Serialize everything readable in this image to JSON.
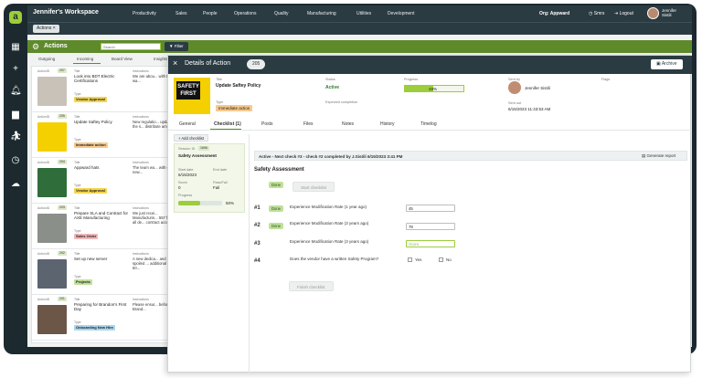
{
  "app": {
    "workspace_title": "Jennifer's Workspace",
    "nav": [
      "Productivity",
      "Sales",
      "People",
      "Operations",
      "Quality",
      "Manufacturing",
      "Utilities",
      "Development"
    ],
    "org": "Org: Appward",
    "smrs": "Smrs",
    "logout": "Logout",
    "user_first": "Jennifer",
    "user_last": "Sistili",
    "actions_chip": "Actions ×"
  },
  "actions": {
    "title": "Actions",
    "search_placeholder": "Search",
    "filter_label": "Filter",
    "tabs": [
      "Outgoing",
      "Incoming",
      "Board View",
      "Insights"
    ]
  },
  "list_labels": {
    "title": "Title",
    "type": "Type",
    "instructions": "Instructions"
  },
  "list": [
    {
      "id": "ActionID",
      "badge": "207",
      "title": "Look into BDT Electric Certifications",
      "type": "Vendor Approval",
      "type_color": "#f4d54d",
      "instr": "We are abou... with the wa...",
      "thumb": "#c9c2b8"
    },
    {
      "id": "ActionID",
      "badge": "205",
      "title": "Update Saftey Policy",
      "type": "Immediate action",
      "type_color": "#f7c98d",
      "instr": "New regulatio... update the s... distribute am...",
      "thumb": "#f4d000"
    },
    {
      "id": "ActionID",
      "badge": "204",
      "title": "Appward hats",
      "type": "Vendor Approval",
      "type_color": "#f4d54d",
      "instr": "The team wo... with our new...",
      "thumb": "#2f6d3a"
    },
    {
      "id": "ActionID",
      "badge": "203",
      "title": "Prepare SLA and Contract for AXE Manufacturing",
      "type": "Sales Order",
      "type_color": "#f0b8b8",
      "instr": "We just recei... Manufacturin... 557 for all de... contract acco...",
      "thumb": "#8a8f8a"
    },
    {
      "id": "ActionID",
      "badge": "202",
      "title": "Set up new server",
      "type": "Projects",
      "type_color": "#bfe09a",
      "instr": "A new dedica... and spoiled ... additional 50...",
      "thumb": "#5c6470"
    },
    {
      "id": "ActionID",
      "badge": "201",
      "title": "Preparing for Brandon's First Day",
      "type": "Onboarding New Hire",
      "type_color": "#a9d6ef",
      "instr": "Please ensur... before Brand...",
      "thumb": "#6c5648"
    }
  ],
  "detail": {
    "header": "Details of Action",
    "number": "205",
    "archive": "Archive",
    "hero_sign": "SAFETY FIRST",
    "labels": {
      "title": "Title",
      "status": "Status",
      "progress": "Progress",
      "sent_by": "Sent by",
      "flags": "Flags",
      "type": "Type",
      "expected": "Expected completion",
      "sent_out": "Sent out"
    },
    "title": "Update Saftey Policy",
    "status": "Active",
    "progress": 0.48,
    "progress_text": "48%",
    "type": "Immediate action",
    "sent_by": "Jennifer Sistili",
    "sent_out": "6/15/2023 11:43:53 AM",
    "tabs": [
      "General",
      "Checklist (1)",
      "Posts",
      "Files",
      "Notes",
      "History",
      "Timelog"
    ]
  },
  "checklist_card": {
    "add_label": "Add checklist",
    "session_label": "Session ID",
    "session_id": "1696",
    "name": "Safety Assessment",
    "start_label": "Start date",
    "start": "6/15/2023",
    "end_label": "End date",
    "score_label": "Score",
    "score": "0",
    "pf_label": "Pass/Fail",
    "pf": "Fail",
    "progress_label": "Progress",
    "progress": 0.5,
    "progress_text": "50%"
  },
  "checklist": {
    "banner": "Active - Next check #3 - check #2 completed by J.Sistili 6/15/2023 3:41 PM",
    "generate": "Generate report",
    "title": "Safety Assessment",
    "done": "Done",
    "start_btn": "Start checklist",
    "finish_btn": "Finish checklist",
    "questions": [
      {
        "num": "#1",
        "text": "Experience Modification Rate (1 year ago)",
        "value": "45",
        "done": true
      },
      {
        "num": "#2",
        "text": "Experience Modification Rate (3 years ago)",
        "value": "78",
        "done": true
      },
      {
        "num": "#3",
        "text": "Experience Modification Rate (3 years ago)",
        "value": "Score",
        "done": false
      },
      {
        "num": "#4",
        "text": "Does the vendor have a written Safety Program?",
        "yes": "Yes",
        "no": "No",
        "done": false
      }
    ]
  }
}
